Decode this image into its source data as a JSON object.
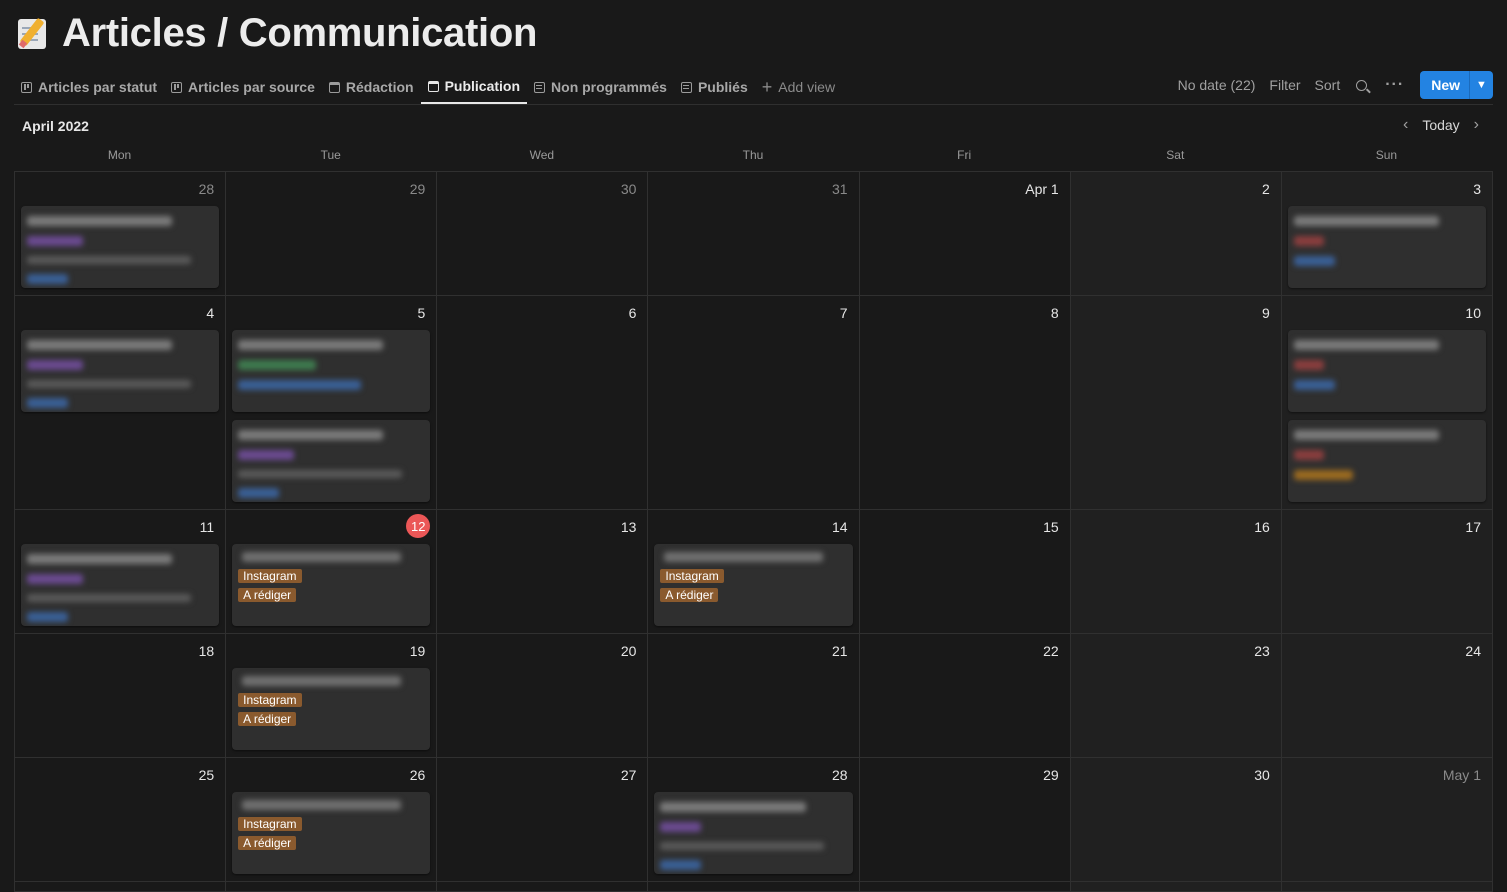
{
  "page": {
    "title": "Articles / Communication",
    "emoji": "memo-icon"
  },
  "tabs": [
    {
      "label": "Articles par statut",
      "icon": "board-icon"
    },
    {
      "label": "Articles par source",
      "icon": "board-icon"
    },
    {
      "label": "Rédaction",
      "icon": "calendar-icon"
    },
    {
      "label": "Publication",
      "icon": "calendar-icon",
      "active": true
    },
    {
      "label": "Non programmés",
      "icon": "list-icon"
    },
    {
      "label": "Publiés",
      "icon": "list-icon"
    }
  ],
  "add_view_label": "Add view",
  "toolbar": {
    "no_date": "No date (22)",
    "filter": "Filter",
    "sort": "Sort",
    "more": "···",
    "new_label": "New"
  },
  "calendar": {
    "month": "April 2022",
    "today_label": "Today",
    "weekdays": [
      "Mon",
      "Tue",
      "Wed",
      "Thu",
      "Fri",
      "Sat",
      "Sun"
    ],
    "days": [
      "28",
      "29",
      "30",
      "31",
      "Apr 1",
      "2",
      "3",
      "4",
      "5",
      "6",
      "7",
      "8",
      "9",
      "10",
      "11",
      "12",
      "13",
      "14",
      "15",
      "16",
      "17",
      "18",
      "19",
      "20",
      "21",
      "22",
      "23",
      "24",
      "25",
      "26",
      "27",
      "28",
      "29",
      "30",
      "May 1"
    ],
    "tags": {
      "instagram": "Instagram",
      "a_rediger": "A rédiger"
    },
    "colors": {
      "accent": "#2383e2",
      "today": "#eb5757",
      "tag": "#8a5a2e"
    }
  }
}
